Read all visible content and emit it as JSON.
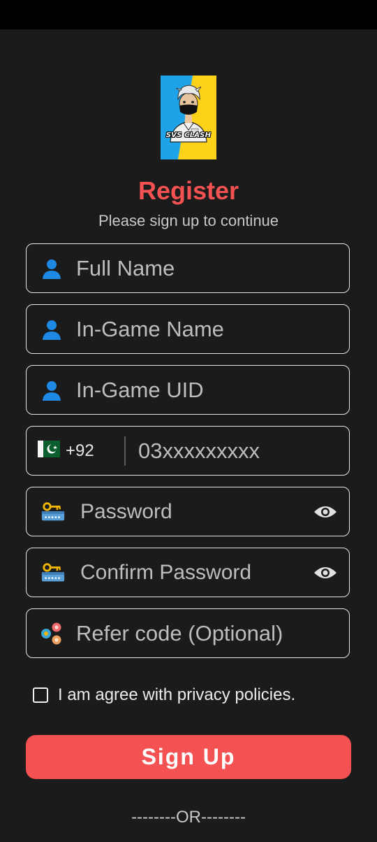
{
  "logo": {
    "text": "SVS CLASH"
  },
  "header": {
    "title": "Register",
    "subtitle": "Please sign up to continue"
  },
  "fields": {
    "full_name": {
      "placeholder": "Full Name",
      "icon": "user-icon"
    },
    "ingame_name": {
      "placeholder": "In-Game Name",
      "icon": "user-icon"
    },
    "ingame_uid": {
      "placeholder": "In-Game UID",
      "icon": "user-icon"
    },
    "phone": {
      "country_code": "+92",
      "placeholder": "03xxxxxxxxx",
      "flag": "pakistan-flag-icon"
    },
    "password": {
      "placeholder": "Password",
      "icon": "key-password-icon",
      "toggle_icon": "eye-icon"
    },
    "confirm_password": {
      "placeholder": "Confirm Password",
      "icon": "key-password-icon",
      "toggle_icon": "eye-icon"
    },
    "refer_code": {
      "placeholder": "Refer code (Optional)",
      "icon": "referral-icon"
    }
  },
  "agree": {
    "label": "I am agree with privacy policies.",
    "checked": false
  },
  "signup_button": {
    "label": "Sign Up"
  },
  "divider": {
    "text": "--------OR--------"
  },
  "colors": {
    "accent": "#f45252",
    "background": "#1b1b1b",
    "border": "#e6e6e6"
  }
}
